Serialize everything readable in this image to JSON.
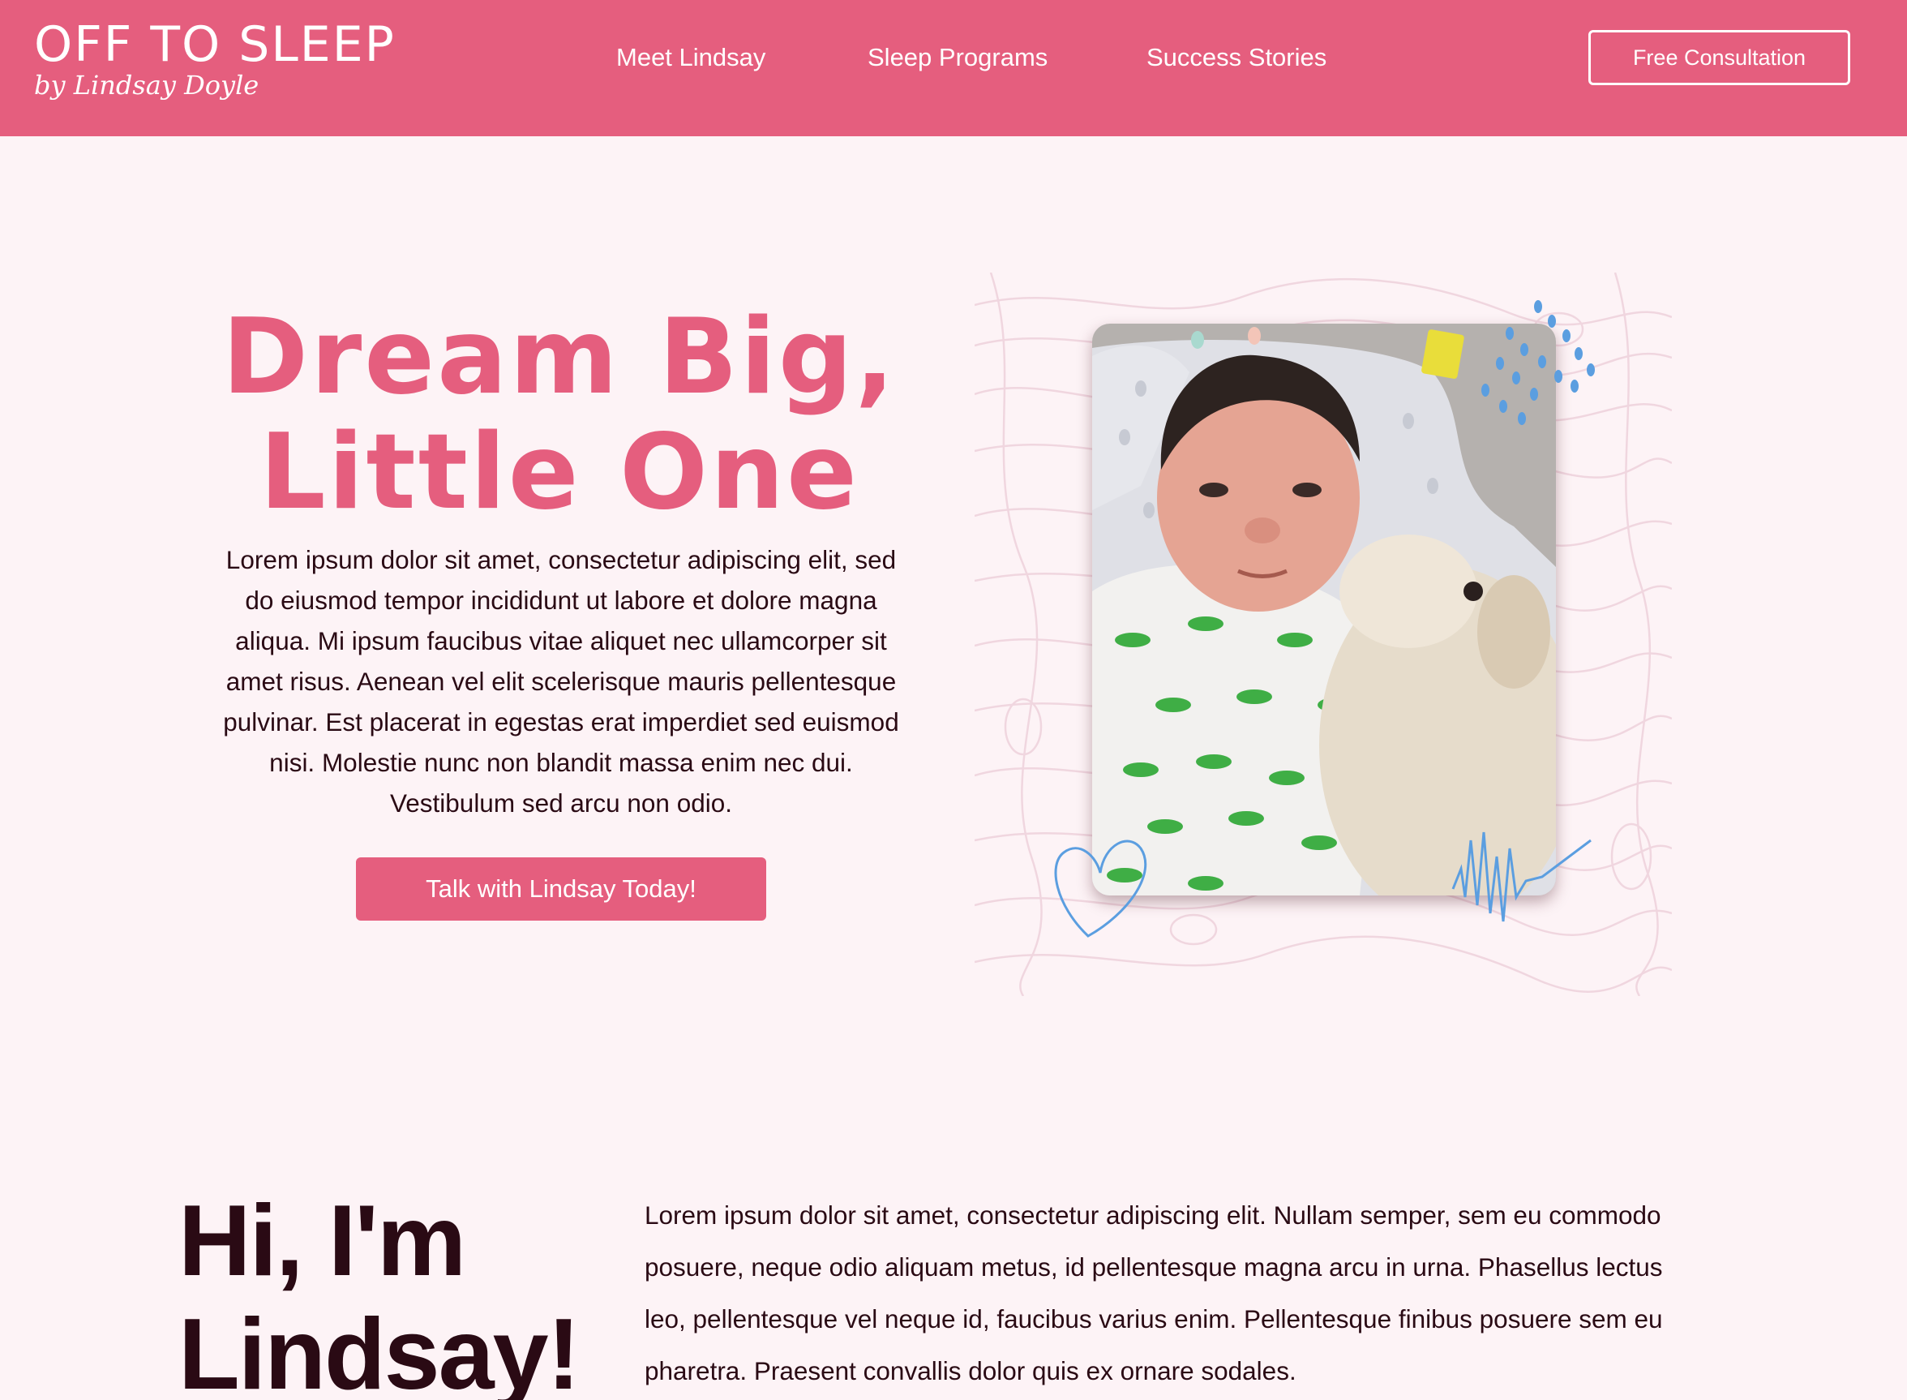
{
  "header": {
    "logo": {
      "main": "OFF TO SLEEP",
      "script": "by Lindsay Doyle"
    },
    "nav": [
      {
        "label": "Meet Lindsay"
      },
      {
        "label": "Sleep Programs"
      },
      {
        "label": "Success Stories"
      }
    ],
    "cta_label": "Free Consultation"
  },
  "hero": {
    "title_line1": "Dream Big,",
    "title_line2": "Little One",
    "body": "Lorem ipsum dolor sit amet, consectetur adipiscing elit, sed do eiusmod tempor incididunt ut labore et dolore magna aliqua. Mi ipsum faucibus vitae aliquet nec ullamcorper sit amet risus. Aenean vel elit scelerisque mauris pellentesque pulvinar. Est placerat in egestas erat imperdiet sed euismod nisi. Molestie nunc non blandit massa enim nec dui. Vestibulum sed arcu non odio.",
    "button_label": "Talk with Lindsay Today!"
  },
  "about": {
    "title_line1": "Hi, I'm",
    "title_line2": "Lindsay!",
    "body": "Lorem ipsum dolor sit amet, consectetur adipiscing elit. Nullam semper, sem eu commodo posuere, neque odio aliquam metus, id pellentesque magna arcu in urna. Phasellus lectus leo, pellentesque vel neque id, faucibus varius enim. Pellentesque finibus posuere sem eu pharetra. Praesent convallis dolor quis ex ornare sodales."
  },
  "colors": {
    "brand_pink": "#e55e7e",
    "background": "#fdf3f6",
    "text_dark": "#2a0a14",
    "accent_blue": "#5b9ee0"
  },
  "icons": [
    "heart-doodle",
    "scribble-doodle",
    "rain-drops-doodle"
  ]
}
